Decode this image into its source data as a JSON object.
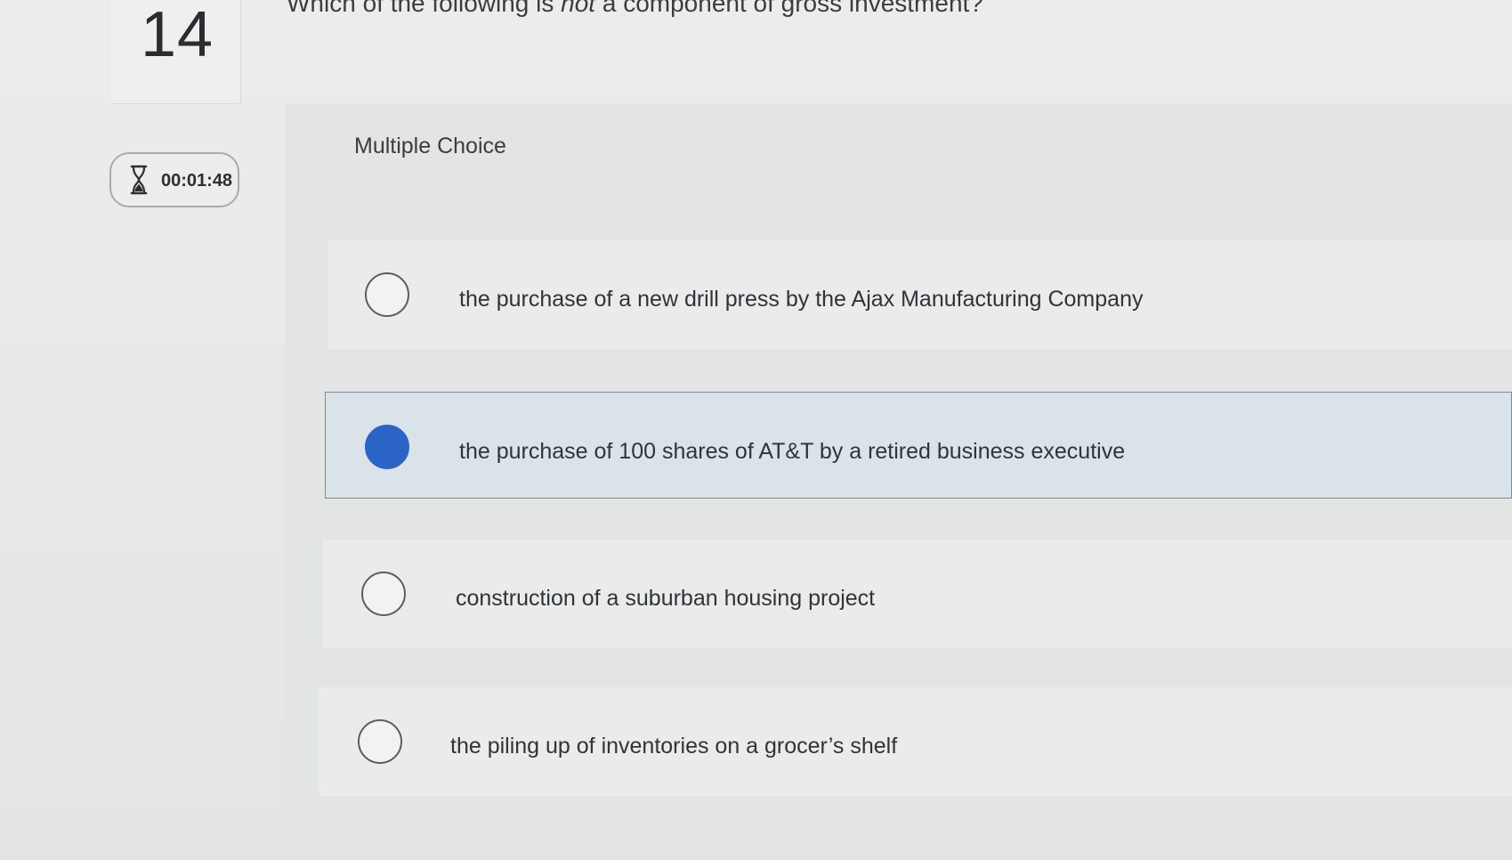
{
  "question": {
    "number": "14",
    "text_before": "Which of the following is ",
    "text_emphasis": "not",
    "text_after": " a component of gross investment?",
    "type_label": "Multiple Choice"
  },
  "timer": {
    "icon": "hourglass-icon",
    "value": "00:01:48"
  },
  "choices": [
    {
      "label": "the purchase of a new drill press by the Ajax Manufacturing Company",
      "selected": false
    },
    {
      "label": "the purchase of 100 shares of AT&T by a retired business executive",
      "selected": true
    },
    {
      "label": "construction of a suburban housing project",
      "selected": false
    },
    {
      "label": "the piling up of inventories on a grocer’s shelf",
      "selected": false
    }
  ],
  "colors": {
    "selected_fill": "#2a64c4",
    "selected_background": "#dbe3ea"
  }
}
